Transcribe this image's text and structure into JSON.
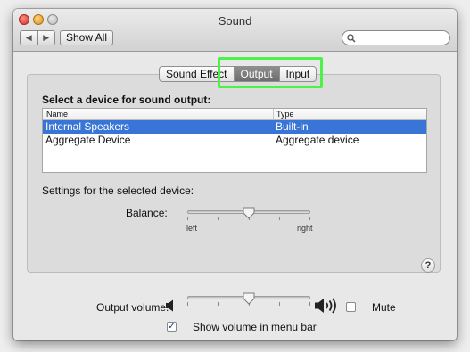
{
  "window": {
    "title": "Sound",
    "nav_back": "◀",
    "nav_forward": "▶",
    "show_all_label": "Show All",
    "search_placeholder": ""
  },
  "tabs": [
    {
      "label": "Sound Effects",
      "shown": "Sound Effect",
      "active": false
    },
    {
      "label": "Output",
      "active": true
    },
    {
      "label": "Input",
      "active": false
    }
  ],
  "output": {
    "section_title": "Select a device for sound output:",
    "table": {
      "columns": [
        "Name",
        "Type"
      ],
      "rows": [
        {
          "name": "Internal Speakers",
          "type": "Built-in",
          "selected": true
        },
        {
          "name": "Aggregate Device",
          "type": "Aggregate device",
          "selected": false
        }
      ]
    },
    "settings_label": "Settings for the selected device:",
    "balance": {
      "label": "Balance:",
      "left_label": "left",
      "right_label": "right",
      "value": 0.5
    }
  },
  "footer": {
    "output_volume_label": "Output volume:",
    "output_volume_value": 0.5,
    "mute_label": "Mute",
    "mute_checked": false,
    "show_volume_label": "Show volume in menu bar",
    "show_volume_checked": true,
    "check_glyph": "✓",
    "help_glyph": "?"
  },
  "colors": {
    "selection": "#3875d7",
    "highlight_box": "#4cf24a",
    "active_tab": "#777777"
  },
  "icons": [
    "search-icon",
    "speaker-low-icon",
    "speaker-high-icon",
    "help-icon",
    "checkmark-icon"
  ]
}
